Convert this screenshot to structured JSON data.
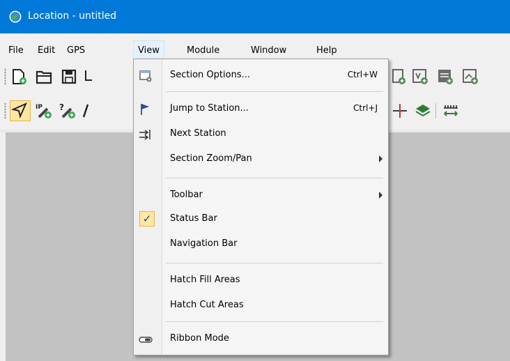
{
  "window": {
    "title": "Location - untitled"
  },
  "menubar": {
    "items": [
      {
        "label": "File"
      },
      {
        "label": "Edit"
      },
      {
        "label": "GPS"
      },
      {
        "label": "View"
      },
      {
        "label": "Module"
      },
      {
        "label": "Window"
      },
      {
        "label": "Help"
      }
    ]
  },
  "view_menu": {
    "section_options": {
      "label": "Section Options...",
      "shortcut": "Ctrl+W"
    },
    "jump_to_station": {
      "label": "Jump to Station...",
      "shortcut": "Ctrl+J"
    },
    "next_station": {
      "label": "Next Station"
    },
    "section_zoom_pan": {
      "label": "Section Zoom/Pan"
    },
    "toolbar": {
      "label": "Toolbar"
    },
    "status_bar": {
      "label": "Status Bar",
      "checked": true,
      "check_glyph": "✓"
    },
    "navigation_bar": {
      "label": "Navigation Bar"
    },
    "hatch_fill_areas": {
      "label": "Hatch Fill Areas"
    },
    "hatch_cut_areas": {
      "label": "Hatch Cut Areas"
    },
    "ribbon_mode": {
      "label": "Ribbon Mode"
    }
  },
  "colors": {
    "titlebar": "#0078d7",
    "workarea": "#c2c2c2",
    "active_highlight": "#fde6a2",
    "accent_green": "#3aa84f"
  }
}
